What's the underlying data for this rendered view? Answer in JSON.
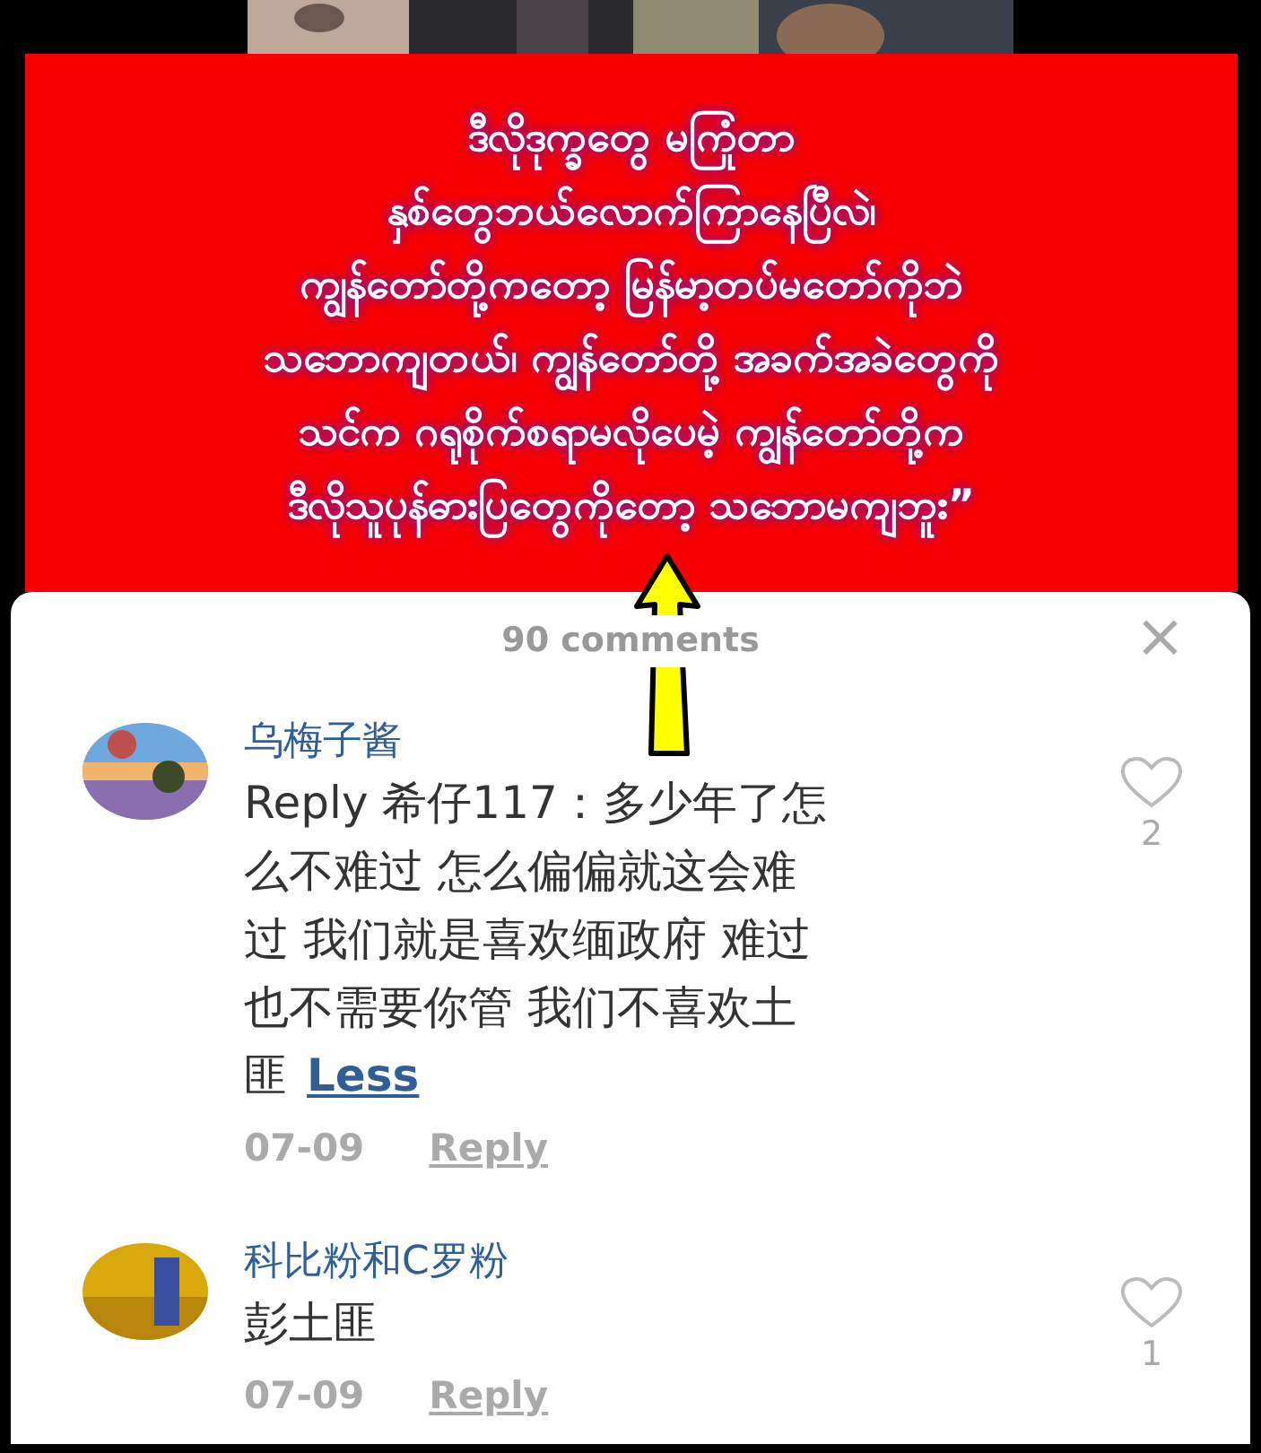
{
  "caption": "ဒီလိုဒုက္ခတွေ မကြုံတာ\nနှစ်တွေဘယ်လောက်ကြာနေပြီလဲ၊\nကျွန်တော်တို့ကတော့ မြန်မာ့တပ်မတော်ကိုဘဲ\nသဘောကျတယ်၊ ကျွန်တော်တို့ အခက်အခဲတွေကို\nသင်က ဂရုစိုက်စရာမလိုပေမဲ့ ကျွန်တော်တို့က\nဒီလိုသူပုန်ဓားပြတွေကိုတော့ သဘောမကျဘူး”",
  "comments_panel": {
    "title": "90 comments",
    "close": "×",
    "comments": [
      {
        "author": "乌梅子酱",
        "text_lines": [
          "Reply 希仔117：多少年了怎",
          "么不难过 怎么偏偏就这会难",
          "过 我们就是喜欢缅政府 难过",
          "也不需要你管 我们不喜欢土",
          "匪"
        ],
        "toggle": "Less",
        "likes": "2",
        "liked": false,
        "date": "07-09",
        "reply": "Reply"
      },
      {
        "author": "科比粉和C罗粉",
        "text_lines": [
          "彭土匪"
        ],
        "likes": "1",
        "liked": false,
        "date": "07-09",
        "reply": "Reply"
      }
    ]
  }
}
